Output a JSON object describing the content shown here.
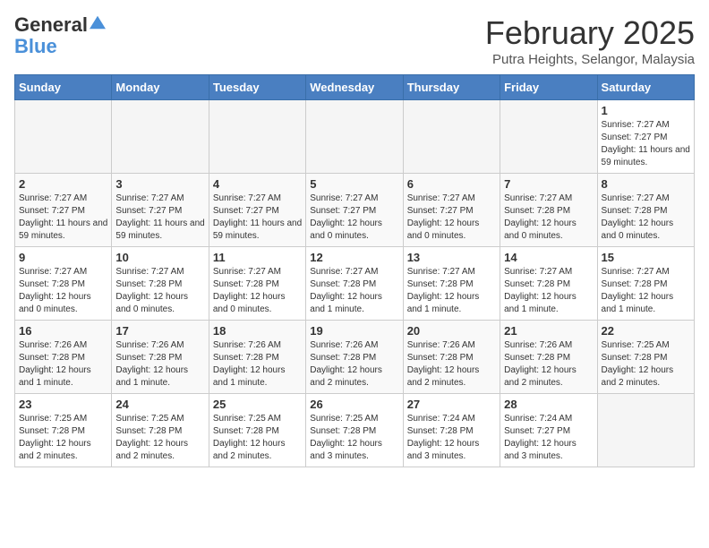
{
  "logo": {
    "line1": "General",
    "line2": "Blue"
  },
  "title": "February 2025",
  "subtitle": "Putra Heights, Selangor, Malaysia",
  "days_of_week": [
    "Sunday",
    "Monday",
    "Tuesday",
    "Wednesday",
    "Thursday",
    "Friday",
    "Saturday"
  ],
  "weeks": [
    [
      {
        "day": "",
        "info": ""
      },
      {
        "day": "",
        "info": ""
      },
      {
        "day": "",
        "info": ""
      },
      {
        "day": "",
        "info": ""
      },
      {
        "day": "",
        "info": ""
      },
      {
        "day": "",
        "info": ""
      },
      {
        "day": "1",
        "info": "Sunrise: 7:27 AM\nSunset: 7:27 PM\nDaylight: 11 hours and 59 minutes."
      }
    ],
    [
      {
        "day": "2",
        "info": "Sunrise: 7:27 AM\nSunset: 7:27 PM\nDaylight: 11 hours and 59 minutes."
      },
      {
        "day": "3",
        "info": "Sunrise: 7:27 AM\nSunset: 7:27 PM\nDaylight: 11 hours and 59 minutes."
      },
      {
        "day": "4",
        "info": "Sunrise: 7:27 AM\nSunset: 7:27 PM\nDaylight: 11 hours and 59 minutes."
      },
      {
        "day": "5",
        "info": "Sunrise: 7:27 AM\nSunset: 7:27 PM\nDaylight: 12 hours and 0 minutes."
      },
      {
        "day": "6",
        "info": "Sunrise: 7:27 AM\nSunset: 7:27 PM\nDaylight: 12 hours and 0 minutes."
      },
      {
        "day": "7",
        "info": "Sunrise: 7:27 AM\nSunset: 7:28 PM\nDaylight: 12 hours and 0 minutes."
      },
      {
        "day": "8",
        "info": "Sunrise: 7:27 AM\nSunset: 7:28 PM\nDaylight: 12 hours and 0 minutes."
      }
    ],
    [
      {
        "day": "9",
        "info": "Sunrise: 7:27 AM\nSunset: 7:28 PM\nDaylight: 12 hours and 0 minutes."
      },
      {
        "day": "10",
        "info": "Sunrise: 7:27 AM\nSunset: 7:28 PM\nDaylight: 12 hours and 0 minutes."
      },
      {
        "day": "11",
        "info": "Sunrise: 7:27 AM\nSunset: 7:28 PM\nDaylight: 12 hours and 0 minutes."
      },
      {
        "day": "12",
        "info": "Sunrise: 7:27 AM\nSunset: 7:28 PM\nDaylight: 12 hours and 1 minute."
      },
      {
        "day": "13",
        "info": "Sunrise: 7:27 AM\nSunset: 7:28 PM\nDaylight: 12 hours and 1 minute."
      },
      {
        "day": "14",
        "info": "Sunrise: 7:27 AM\nSunset: 7:28 PM\nDaylight: 12 hours and 1 minute."
      },
      {
        "day": "15",
        "info": "Sunrise: 7:27 AM\nSunset: 7:28 PM\nDaylight: 12 hours and 1 minute."
      }
    ],
    [
      {
        "day": "16",
        "info": "Sunrise: 7:26 AM\nSunset: 7:28 PM\nDaylight: 12 hours and 1 minute."
      },
      {
        "day": "17",
        "info": "Sunrise: 7:26 AM\nSunset: 7:28 PM\nDaylight: 12 hours and 1 minute."
      },
      {
        "day": "18",
        "info": "Sunrise: 7:26 AM\nSunset: 7:28 PM\nDaylight: 12 hours and 1 minute."
      },
      {
        "day": "19",
        "info": "Sunrise: 7:26 AM\nSunset: 7:28 PM\nDaylight: 12 hours and 2 minutes."
      },
      {
        "day": "20",
        "info": "Sunrise: 7:26 AM\nSunset: 7:28 PM\nDaylight: 12 hours and 2 minutes."
      },
      {
        "day": "21",
        "info": "Sunrise: 7:26 AM\nSunset: 7:28 PM\nDaylight: 12 hours and 2 minutes."
      },
      {
        "day": "22",
        "info": "Sunrise: 7:25 AM\nSunset: 7:28 PM\nDaylight: 12 hours and 2 minutes."
      }
    ],
    [
      {
        "day": "23",
        "info": "Sunrise: 7:25 AM\nSunset: 7:28 PM\nDaylight: 12 hours and 2 minutes."
      },
      {
        "day": "24",
        "info": "Sunrise: 7:25 AM\nSunset: 7:28 PM\nDaylight: 12 hours and 2 minutes."
      },
      {
        "day": "25",
        "info": "Sunrise: 7:25 AM\nSunset: 7:28 PM\nDaylight: 12 hours and 2 minutes."
      },
      {
        "day": "26",
        "info": "Sunrise: 7:25 AM\nSunset: 7:28 PM\nDaylight: 12 hours and 3 minutes."
      },
      {
        "day": "27",
        "info": "Sunrise: 7:24 AM\nSunset: 7:28 PM\nDaylight: 12 hours and 3 minutes."
      },
      {
        "day": "28",
        "info": "Sunrise: 7:24 AM\nSunset: 7:27 PM\nDaylight: 12 hours and 3 minutes."
      },
      {
        "day": "",
        "info": ""
      }
    ]
  ]
}
